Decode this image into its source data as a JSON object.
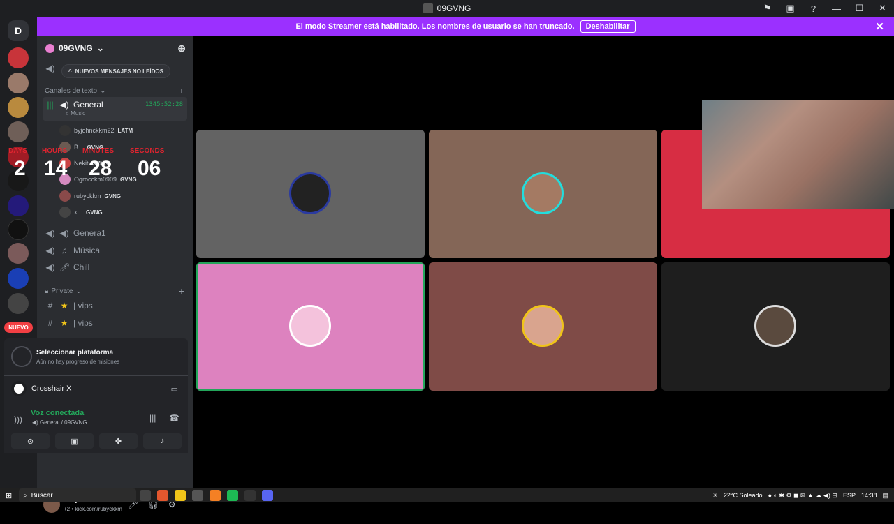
{
  "window": {
    "title": "09GVNG"
  },
  "banner": {
    "text": "El modo Streamer está habilitado. Los nombres de usuario se han truncado.",
    "button": "Deshabilitar"
  },
  "guilds": {
    "new_badge": "NUEVO"
  },
  "server": {
    "name": "09GVNG",
    "unread_pill": "NUEVOS MENSAJES NO LEÍDOS"
  },
  "categories": {
    "text_channels": "Canales de texto",
    "private": "Private"
  },
  "channels": {
    "general": {
      "name": "General",
      "timer": "1345:52:28",
      "activity": "Music"
    },
    "general1": "Genera1",
    "musica": "Música",
    "chill": "Chill",
    "vips1": "vips",
    "vips2": "vips"
  },
  "voice_users": [
    {
      "name": "byjohnckkm22",
      "tag": "LATM"
    },
    {
      "name": "B...",
      "tag": "GVNG"
    },
    {
      "name": "Nekit",
      "tag": "GVNG"
    },
    {
      "name": "Ogrocckm0909",
      "tag": "GVNG"
    },
    {
      "name": "rubyckkm",
      "tag": "GVNG"
    },
    {
      "name": "x...",
      "tag": "GVNG"
    }
  ],
  "countdown": {
    "labels": {
      "days": "DAYS",
      "hours": "HOURS",
      "minutes": "MINUTES",
      "seconds": "SECONDS"
    },
    "days": "2",
    "hours": "14",
    "minutes": "28",
    "seconds": "06"
  },
  "quest": {
    "title": "Seleccionar plataforma",
    "subtitle": "Aún no hay progreso de misiones",
    "app_name": "Crosshair X"
  },
  "voice_status": {
    "title": "Voz conectada",
    "subtitle": "General / 09GVNG"
  },
  "user": {
    "name": "rubyckkm",
    "status": "+2 • kick.com/rubyckkm"
  },
  "tiles": [
    {
      "bg": "#636363"
    },
    {
      "bg": "#846657"
    },
    {
      "bg": "#d72d43"
    },
    {
      "bg": "#dd82bf"
    },
    {
      "bg": "#7f4b47"
    },
    {
      "bg": "#1e1e1e"
    }
  ],
  "taskbar": {
    "search": "Buscar",
    "weather": "22°C  Soleado",
    "lang": "ESP",
    "time": "14:38"
  },
  "colors": {
    "accent": "#9b30ff",
    "online": "#23a55a",
    "countdown": "#e0242f"
  }
}
